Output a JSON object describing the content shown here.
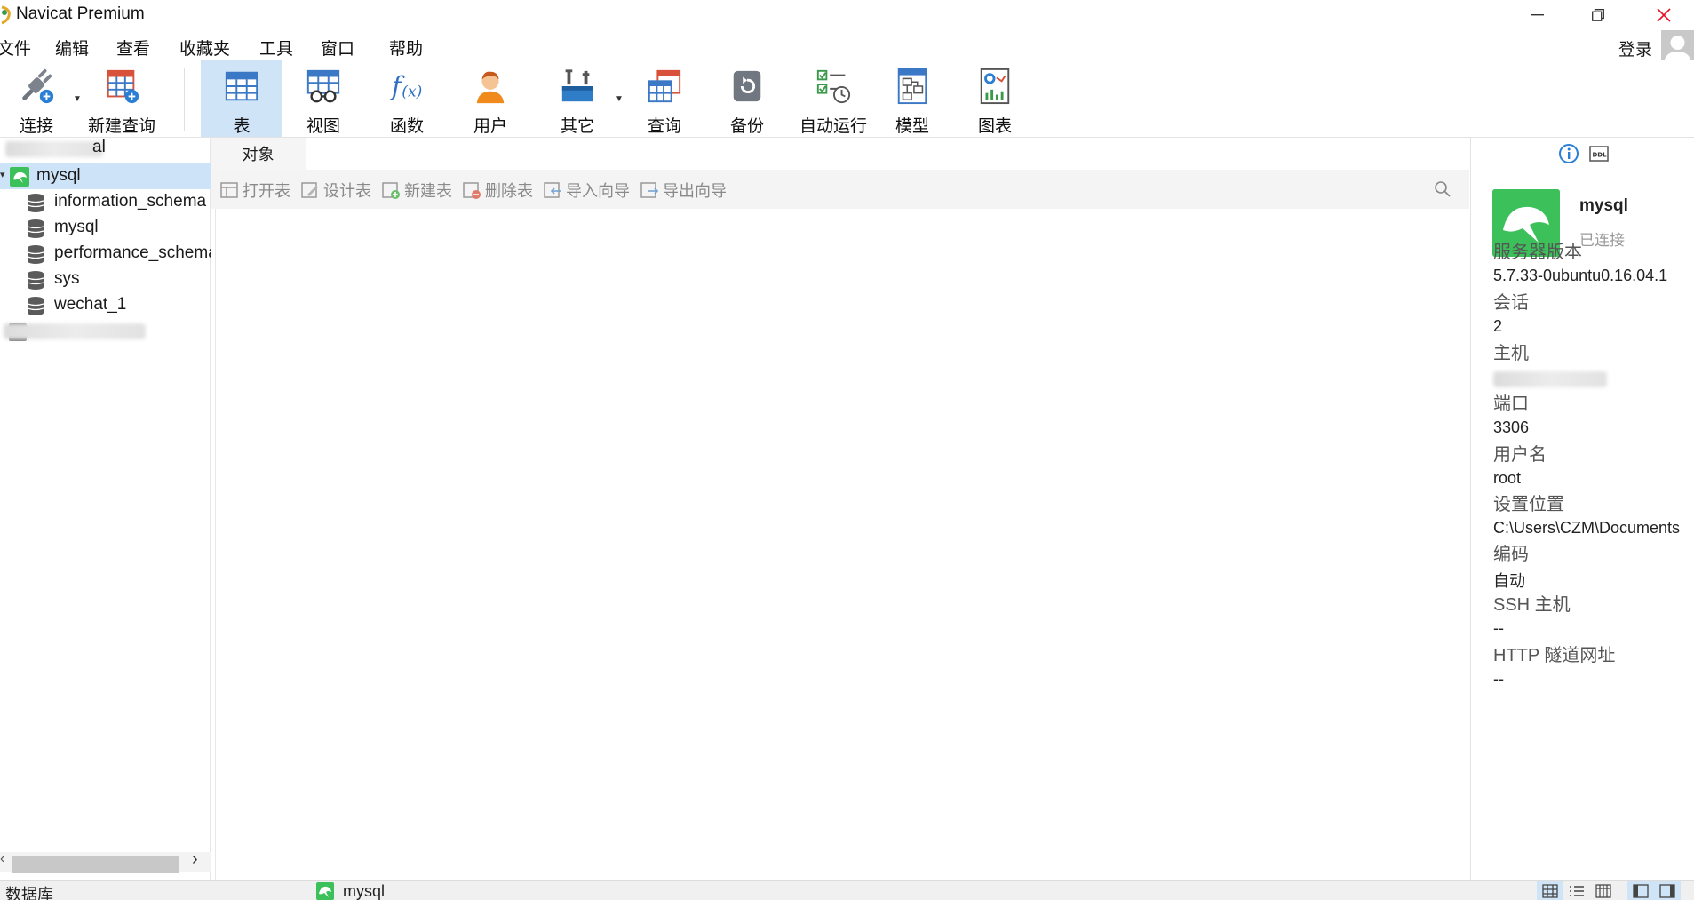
{
  "window": {
    "title": "Navicat Premium",
    "accent_color": "#3cc15a",
    "close_color": "#e81123"
  },
  "menu": {
    "items": [
      "文件",
      "编辑",
      "查看",
      "收藏夹",
      "工具",
      "窗口",
      "帮助"
    ],
    "login": "登录"
  },
  "toolbar": {
    "connect": "连接",
    "new_query": "新建查询",
    "table": "表",
    "view": "视图",
    "function": "函数",
    "user": "用户",
    "other": "其它",
    "query": "查询",
    "backup": "备份",
    "automation": "自动运行",
    "model": "模型",
    "chart": "图表",
    "active": "表"
  },
  "sidebar": {
    "top_partial": "al",
    "connection": "mysql",
    "databases": [
      "information_schema",
      "mysql",
      "performance_schema",
      "sys",
      "wechat_1"
    ]
  },
  "center": {
    "tab": "对象",
    "actions": {
      "open_table": "打开表",
      "design_table": "设计表",
      "new_table": "新建表",
      "delete_table": "删除表",
      "import_wizard": "导入向导",
      "export_wizard": "导出向导"
    }
  },
  "info_panel": {
    "name": "mysql",
    "status": "已连接",
    "fields": {
      "server_version_label": "服务器版本",
      "server_version": "5.7.33-0ubuntu0.16.04.1",
      "sessions_label": "会话",
      "sessions": "2",
      "host_label": "主机",
      "port_label": "端口",
      "port": "3306",
      "username_label": "用户名",
      "username": "root",
      "settings_location_label": "设置位置",
      "settings_location": "C:\\Users\\CZM\\Documents",
      "encoding_label": "编码",
      "encoding": "自动",
      "ssh_host_label": "SSH 主机",
      "ssh_host": "--",
      "http_tunnel_label": "HTTP 隧道网址",
      "http_tunnel": "--"
    }
  },
  "status_bar": {
    "left": "数据库",
    "connection": "mysql"
  }
}
